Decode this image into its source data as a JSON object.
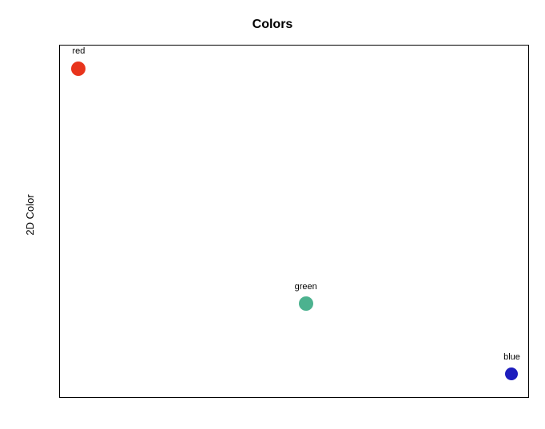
{
  "chart_data": {
    "type": "scatter",
    "title": "Colors",
    "xlabel": "",
    "ylabel": "2D Color",
    "xlim": [
      0,
      100
    ],
    "ylim": [
      0,
      100
    ],
    "series": [
      {
        "name": "red",
        "x": 4,
        "y": 96,
        "color": "#e8341c"
      },
      {
        "name": "green",
        "x": 52.5,
        "y": 27,
        "color": "#4cb28f"
      },
      {
        "name": "blue",
        "x": 96.5,
        "y": 6,
        "color": "#1d1dbd"
      }
    ]
  }
}
